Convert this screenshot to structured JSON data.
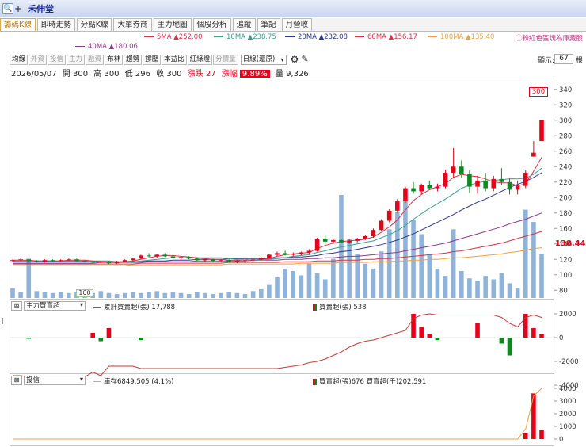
{
  "titlebar": {
    "zoom_icon": "🔍",
    "plus": "+",
    "stock_name": "禾伸堂"
  },
  "tabs": [
    {
      "label": "籌碼K線",
      "active": true
    },
    {
      "label": "即時走勢",
      "active": false
    },
    {
      "label": "分點K線",
      "active": false
    },
    {
      "label": "大單券商",
      "active": false
    },
    {
      "label": "主力地圖",
      "active": false
    },
    {
      "label": "個股分析",
      "active": false
    },
    {
      "label": "追蹤",
      "active": false
    },
    {
      "label": "筆記",
      "active": false
    },
    {
      "label": "月營收",
      "active": false
    }
  ],
  "ma_legend": [
    {
      "label": "5MA ▲252.00",
      "color": "#d6334a"
    },
    {
      "label": "10MA ▲238.75",
      "color": "#3aa08a"
    },
    {
      "label": "20MA ▲232.08",
      "color": "#2b3a8c"
    },
    {
      "label": "60MA ▲156.17",
      "color": "#d6334a"
    },
    {
      "label": "100MA ▲135.40",
      "color": "#f0a040"
    },
    {
      "label": "40MA ▲180.06",
      "color": "#8a3a8a"
    }
  ],
  "note": "ⓘ粉紅色區塊為庫藏股",
  "toolbar": {
    "buttons": [
      {
        "label": "均線",
        "dim": false
      },
      {
        "label": "外資",
        "dim": true
      },
      {
        "label": "投信",
        "dim": true
      },
      {
        "label": "主力",
        "dim": true
      },
      {
        "label": "融資",
        "dim": true
      },
      {
        "label": "布林",
        "dim": false
      },
      {
        "label": "趨勢",
        "dim": false
      },
      {
        "label": "撐壓",
        "dim": false
      },
      {
        "label": "本益比",
        "dim": false
      },
      {
        "label": "紅綠燈",
        "dim": false
      },
      {
        "label": "分價量",
        "dim": true
      }
    ],
    "period_select": "日線(還原)",
    "gear_icon": "⚙",
    "pen_icon": "✎",
    "display_label": "顯示:",
    "display_value": "67",
    "display_unit": "根"
  },
  "quote": {
    "date": "2026/05/07",
    "open": "開 300",
    "high": "高 300",
    "low": "低 296",
    "close": "收 300",
    "change": "漲跌 27",
    "pct_label": "漲幅",
    "pct": "9.89%",
    "volume": "量 9,326"
  },
  "main_chart": {
    "y_ticks": [
      "340",
      "320",
      "300",
      "280",
      "260",
      "240",
      "220",
      "200",
      "180",
      "160",
      "140",
      "120",
      "100",
      "80"
    ],
    "last_price_label": "138.44",
    "high_label": "300",
    "low_label": "100"
  },
  "sub1": {
    "box": "⊠",
    "select": "主力買賣超",
    "legend_line": "累計買賣超(張) 17,788",
    "legend_bar": "買賣超(張) 538",
    "y_ticks": [
      "2000",
      "0",
      "-2000",
      "-4000"
    ]
  },
  "sub2": {
    "box": "⊠",
    "select": "投信",
    "legend_line": "庫存6849.505 (4.1%)",
    "legend_bar": "買賣超(張)676 買賣超(千)202,591",
    "y_ticks": [
      "4000",
      "3000",
      "2000",
      "1000",
      "0"
    ]
  },
  "colors": {
    "up": "#e8001b",
    "down": "#0b8a1e",
    "volume": "#8fb3d9",
    "accent": "#b26b00"
  },
  "chart_data": {
    "type": "candlestick",
    "y_range": [
      70,
      350
    ],
    "candles": [
      [
        118,
        120,
        117,
        119
      ],
      [
        119,
        121,
        118,
        120
      ],
      [
        120,
        120,
        117,
        118
      ],
      [
        118,
        119,
        116,
        117
      ],
      [
        117,
        120,
        116,
        119
      ],
      [
        119,
        120,
        117,
        118
      ],
      [
        118,
        120,
        117,
        119
      ],
      [
        119,
        121,
        118,
        120
      ],
      [
        120,
        121,
        117,
        118
      ],
      [
        118,
        119,
        116,
        117
      ],
      [
        117,
        118,
        115,
        116
      ],
      [
        116,
        118,
        115,
        117
      ],
      [
        117,
        118,
        114,
        115
      ],
      [
        115,
        118,
        114,
        117
      ],
      [
        117,
        120,
        116,
        119
      ],
      [
        119,
        122,
        118,
        121
      ],
      [
        121,
        126,
        120,
        125
      ],
      [
        125,
        128,
        123,
        124
      ],
      [
        124,
        127,
        122,
        126
      ],
      [
        126,
        128,
        123,
        124
      ],
      [
        124,
        126,
        121,
        122
      ],
      [
        122,
        124,
        120,
        123
      ],
      [
        123,
        124,
        120,
        121
      ],
      [
        121,
        122,
        118,
        119
      ],
      [
        119,
        121,
        117,
        120
      ],
      [
        120,
        121,
        117,
        118
      ],
      [
        118,
        120,
        116,
        119
      ],
      [
        119,
        120,
        116,
        117
      ],
      [
        117,
        119,
        115,
        118
      ],
      [
        118,
        120,
        116,
        119
      ],
      [
        119,
        121,
        117,
        120
      ],
      [
        120,
        123,
        119,
        122
      ],
      [
        122,
        127,
        121,
        126
      ],
      [
        126,
        130,
        124,
        128
      ],
      [
        128,
        131,
        125,
        126
      ],
      [
        126,
        129,
        124,
        127
      ],
      [
        127,
        130,
        125,
        129
      ],
      [
        129,
        133,
        127,
        131
      ],
      [
        131,
        148,
        130,
        146
      ],
      [
        146,
        152,
        140,
        143
      ],
      [
        143,
        147,
        140,
        145
      ],
      [
        145,
        147,
        141,
        142
      ],
      [
        142,
        146,
        140,
        144
      ],
      [
        144,
        148,
        142,
        146
      ],
      [
        146,
        152,
        145,
        150
      ],
      [
        150,
        160,
        148,
        158
      ],
      [
        158,
        172,
        157,
        170
      ],
      [
        170,
        185,
        168,
        183
      ],
      [
        183,
        198,
        180,
        195
      ],
      [
        195,
        214,
        193,
        212
      ],
      [
        212,
        220,
        205,
        208
      ],
      [
        208,
        218,
        204,
        216
      ],
      [
        216,
        222,
        210,
        212
      ],
      [
        212,
        218,
        208,
        214
      ],
      [
        214,
        236,
        212,
        232
      ],
      [
        232,
        264,
        226,
        240
      ],
      [
        240,
        248,
        226,
        230
      ],
      [
        230,
        235,
        206,
        214
      ],
      [
        214,
        228,
        205,
        222
      ],
      [
        222,
        232,
        208,
        212
      ],
      [
        212,
        228,
        208,
        224
      ],
      [
        224,
        238,
        216,
        220
      ],
      [
        220,
        226,
        204,
        210
      ],
      [
        210,
        222,
        204,
        215
      ],
      [
        215,
        235,
        212,
        232
      ],
      [
        253,
        273,
        253,
        258
      ],
      [
        273,
        300,
        296,
        300
      ]
    ],
    "volumes": [
      20,
      12,
      80,
      14,
      12,
      10,
      12,
      10,
      12,
      8,
      10,
      14,
      10,
      8,
      10,
      12,
      10,
      12,
      14,
      10,
      12,
      10,
      8,
      12,
      10,
      8,
      10,
      12,
      10,
      8,
      14,
      18,
      28,
      42,
      60,
      55,
      46,
      70,
      50,
      38,
      80,
      210,
      120,
      90,
      70,
      60,
      95,
      140,
      175,
      200,
      160,
      130,
      90,
      60,
      45,
      140,
      55,
      40,
      35,
      45,
      38,
      50,
      30,
      20,
      180,
      155,
      90
    ],
    "ma5": [
      119,
      119,
      119,
      118,
      118,
      118,
      118,
      119,
      119,
      119,
      118,
      117,
      116,
      116,
      117,
      118,
      120,
      122,
      124,
      125,
      125,
      124,
      123,
      122,
      121,
      120,
      120,
      119,
      119,
      118,
      119,
      120,
      121,
      124,
      126,
      127,
      128,
      129,
      134,
      138,
      141,
      143,
      144,
      145,
      146,
      149,
      155,
      162,
      171,
      184,
      196,
      204,
      210,
      214,
      218,
      226,
      230,
      228,
      227,
      224,
      220,
      219,
      219,
      215,
      218,
      234,
      252
    ],
    "ma10": [
      118,
      118,
      118,
      118,
      118,
      118,
      118,
      118,
      118,
      118,
      118,
      118,
      118,
      117,
      117,
      117,
      118,
      119,
      120,
      121,
      122,
      122,
      122,
      122,
      122,
      122,
      122,
      121,
      120,
      120,
      119,
      119,
      120,
      121,
      122,
      124,
      125,
      126,
      129,
      131,
      134,
      136,
      138,
      140,
      142,
      144,
      148,
      152,
      157,
      164,
      172,
      179,
      186,
      192,
      198,
      205,
      212,
      216,
      219,
      221,
      222,
      223,
      224,
      224,
      225,
      230,
      238
    ],
    "ma20": [
      117,
      117,
      117,
      117,
      117,
      117,
      117,
      117,
      117,
      117,
      117,
      117,
      117,
      117,
      117,
      117,
      117,
      118,
      118,
      118,
      119,
      119,
      119,
      120,
      120,
      120,
      120,
      121,
      121,
      121,
      121,
      121,
      121,
      122,
      122,
      123,
      123,
      124,
      125,
      127,
      128,
      130,
      131,
      133,
      135,
      137,
      139,
      142,
      145,
      149,
      153,
      158,
      163,
      168,
      173,
      178,
      184,
      189,
      194,
      198,
      203,
      208,
      213,
      217,
      221,
      226,
      232
    ],
    "ma40": [
      115,
      115,
      115,
      115,
      115,
      115,
      115,
      115,
      115,
      115,
      115,
      116,
      116,
      116,
      116,
      116,
      116,
      117,
      117,
      117,
      117,
      117,
      117,
      118,
      118,
      118,
      118,
      118,
      118,
      118,
      119,
      119,
      119,
      119,
      120,
      120,
      120,
      121,
      121,
      122,
      122,
      123,
      124,
      124,
      125,
      126,
      127,
      128,
      129,
      131,
      133,
      135,
      137,
      139,
      141,
      144,
      147,
      150,
      153,
      156,
      159,
      162,
      166,
      169,
      172,
      176,
      180
    ],
    "ma60": [
      114,
      114,
      114,
      114,
      114,
      114,
      114,
      114,
      114,
      114,
      114,
      114,
      114,
      114,
      114,
      114,
      115,
      115,
      115,
      115,
      115,
      115,
      115,
      115,
      115,
      115,
      115,
      116,
      116,
      116,
      116,
      116,
      116,
      116,
      117,
      117,
      117,
      117,
      118,
      118,
      118,
      119,
      119,
      119,
      120,
      120,
      121,
      121,
      122,
      123,
      124,
      125,
      126,
      127,
      128,
      130,
      131,
      133,
      135,
      137,
      139,
      141,
      144,
      147,
      150,
      153,
      156
    ],
    "ma100": [
      112,
      112,
      112,
      112,
      112,
      112,
      112,
      112,
      112,
      112,
      112,
      112,
      112,
      112,
      112,
      113,
      113,
      113,
      113,
      113,
      113,
      113,
      113,
      113,
      113,
      113,
      113,
      114,
      114,
      114,
      114,
      114,
      114,
      114,
      114,
      114,
      115,
      115,
      115,
      115,
      115,
      116,
      116,
      116,
      116,
      117,
      117,
      117,
      118,
      118,
      119,
      119,
      120,
      120,
      121,
      122,
      122,
      123,
      124,
      125,
      126,
      127,
      129,
      130,
      132,
      134,
      135
    ],
    "main_force_bars": [
      0,
      0,
      -100,
      0,
      0,
      0,
      0,
      0,
      0,
      0,
      400,
      -300,
      800,
      0,
      0,
      0,
      -200,
      0,
      0,
      0,
      0,
      0,
      0,
      0,
      0,
      0,
      0,
      0,
      0,
      0,
      0,
      0,
      0,
      0,
      0,
      0,
      0,
      0,
      0,
      0,
      0,
      0,
      0,
      0,
      0,
      0,
      0,
      0,
      0,
      0,
      2000,
      900,
      300,
      -200,
      0,
      0,
      0,
      0,
      1200,
      0,
      0,
      -500,
      -1500,
      0,
      2000,
      800,
      300
    ],
    "main_force_cum": [
      -3200,
      -3200,
      -3300,
      -3300,
      -3300,
      -3300,
      -3300,
      -3300,
      -3300,
      -3300,
      -2900,
      -3200,
      -2400,
      -2400,
      -2400,
      -2400,
      -2600,
      -2600,
      -2600,
      -2600,
      -2600,
      -2600,
      -2600,
      -2600,
      -2600,
      -2600,
      -2600,
      -2600,
      -2600,
      -2600,
      -2600,
      -2600,
      -2600,
      -2600,
      -2500,
      -2400,
      -2300,
      -2100,
      -2000,
      -1800,
      -1500,
      -1200,
      -800,
      -500,
      -300,
      -200,
      0,
      200,
      400,
      600,
      1600,
      1900,
      2000,
      1900,
      1900,
      1900,
      1900,
      1900,
      1900,
      1900,
      1900,
      1700,
      1200,
      900,
      1700,
      1900,
      1700
    ],
    "trust_bars": [
      0,
      0,
      0,
      0,
      0,
      0,
      0,
      0,
      0,
      0,
      0,
      0,
      0,
      0,
      0,
      0,
      0,
      0,
      0,
      0,
      0,
      0,
      0,
      0,
      0,
      0,
      0,
      0,
      0,
      0,
      0,
      0,
      0,
      0,
      0,
      0,
      0,
      0,
      0,
      0,
      0,
      0,
      0,
      0,
      0,
      0,
      0,
      0,
      0,
      0,
      0,
      0,
      0,
      0,
      0,
      0,
      0,
      0,
      0,
      0,
      0,
      0,
      0,
      0,
      500,
      3600,
      700
    ],
    "trust_inventory": [
      0,
      0,
      0,
      0,
      0,
      0,
      0,
      0,
      0,
      0,
      0,
      0,
      0,
      0,
      0,
      0,
      0,
      0,
      0,
      0,
      0,
      0,
      0,
      0,
      0,
      0,
      0,
      0,
      0,
      0,
      0,
      0,
      0,
      0,
      0,
      0,
      0,
      0,
      0,
      0,
      0,
      0,
      0,
      0,
      0,
      0,
      0,
      0,
      0,
      0,
      0,
      0,
      0,
      0,
      0,
      0,
      0,
      0,
      0,
      0,
      0,
      0,
      0,
      0,
      800,
      3400,
      4000
    ]
  }
}
